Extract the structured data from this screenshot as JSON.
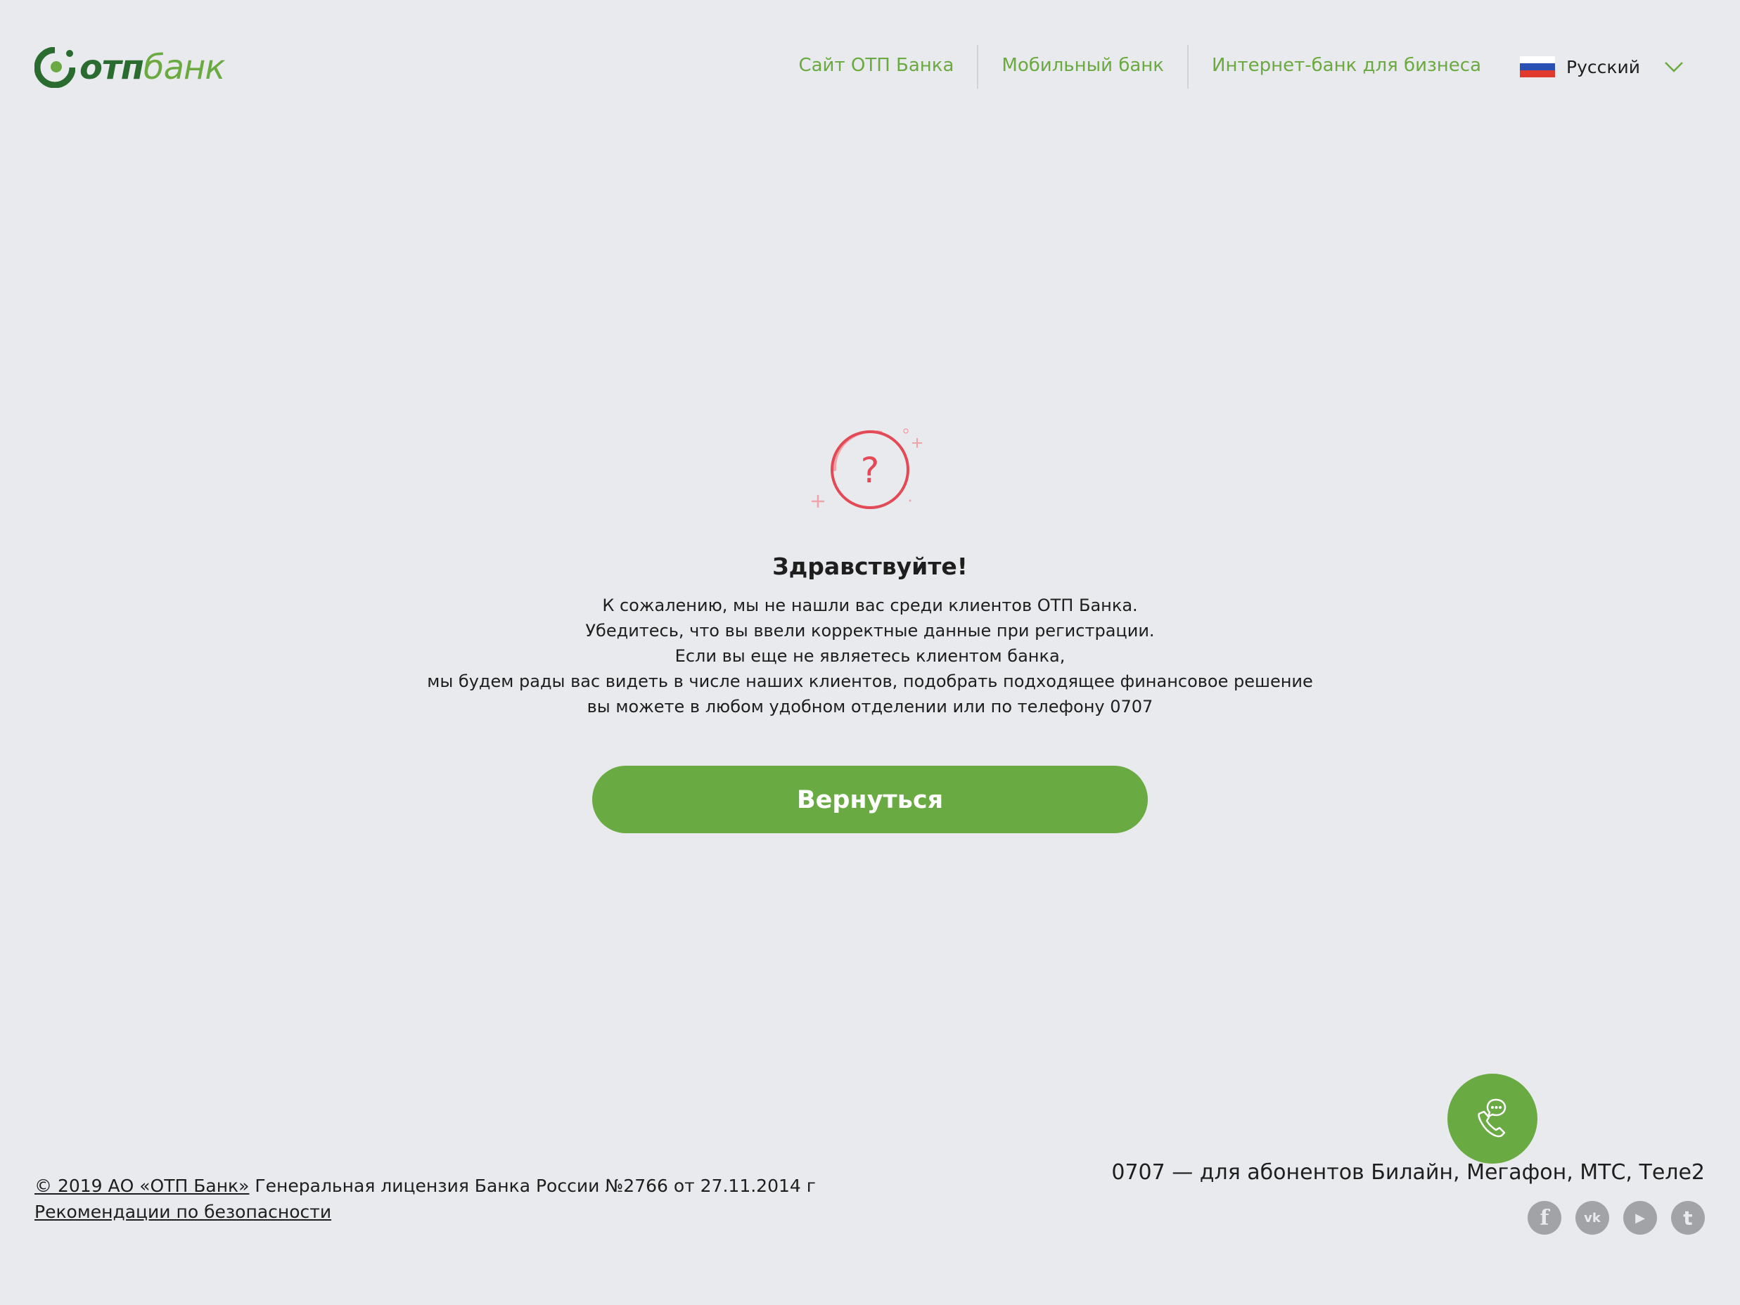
{
  "colors": {
    "brand_green": "#6aaa43",
    "brand_dark_green": "#2a6b2f",
    "accent_red": "#e24a55",
    "background": "#e9eaed"
  },
  "logo": {
    "text_otp": "отп",
    "text_bank": "банк"
  },
  "nav": {
    "links": [
      {
        "label": "Сайт ОТП Банка"
      },
      {
        "label": "Мобильный банк"
      },
      {
        "label": "Интернет-банк для бизнеса"
      }
    ],
    "language": {
      "label": "Русский",
      "flag": "russia-flag-icon"
    }
  },
  "main": {
    "icon": "question-circle-icon",
    "title": "Здравствуйте!",
    "message_lines": [
      "К сожалению, мы не нашли вас среди клиентов ОТП Банка.",
      "Убедитесь, что вы ввели корректные данные при регистрации.",
      "Если вы еще не являетесь клиентом банка,",
      "мы будем рады вас видеть в числе наших клиентов, подобрать подходящее финансовое решение",
      "вы можете в любом удобном отделении или по телефону 0707"
    ],
    "back_button_label": "Вернуться"
  },
  "footer": {
    "copyright_link": "© 2019 АО «ОТП Банк»",
    "license_text": " Генеральная лицензия Банка России №2766 от 27.11.2014 г",
    "security_link": "Рекомендации по безопасности",
    "phone_text": "0707 — для абонентов Билайн, Мегафон, МТС, Теле2",
    "chat_icon": "phone-chat-icon",
    "social": [
      {
        "name": "facebook-icon",
        "glyph": "f"
      },
      {
        "name": "vk-icon",
        "glyph": "vk"
      },
      {
        "name": "youtube-icon",
        "glyph": "▶"
      },
      {
        "name": "twitter-icon",
        "glyph": "t"
      }
    ]
  }
}
